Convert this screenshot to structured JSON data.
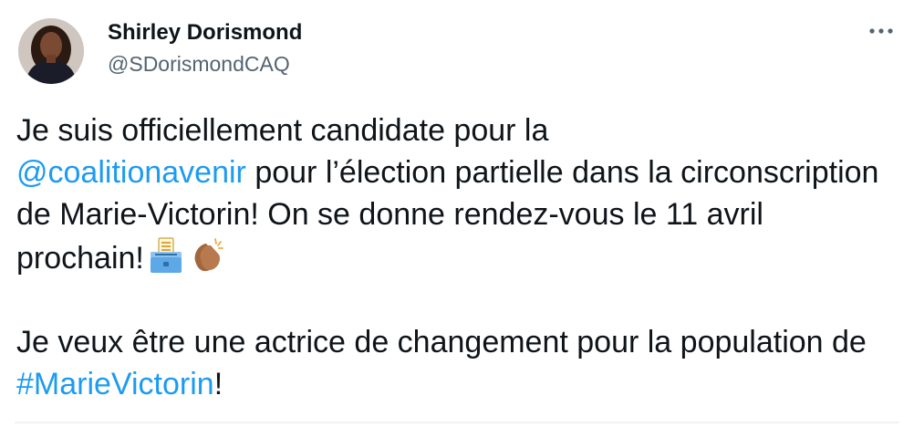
{
  "author": {
    "display_name": "Shirley Dorismond",
    "handle": "@SDorismondCAQ"
  },
  "tweet": {
    "p1_text1": "Je suis officiellement candidate pour la",
    "p1_mention": "@coalitionavenir",
    "p1_text2": " pour l’élection partielle dans la circonscription de Marie-Victorin! On se donne rendez-vous le 11 avril prochain!",
    "p2_text1": "Je veux être une actrice de changement pour la population de ",
    "p2_hashtag": "#MarieVictorin",
    "p2_text2": "!"
  },
  "icons": {
    "more": "more-horizontal-icon",
    "emoji1": "ballot-box-icon",
    "emoji2": "clapping-hands-icon"
  },
  "colors": {
    "link": "#1d9bf0",
    "text": "#0f1419",
    "secondary": "#536471"
  }
}
